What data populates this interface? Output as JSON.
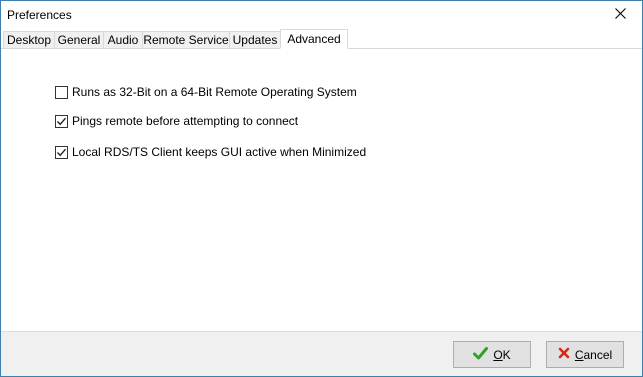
{
  "window": {
    "title": "Preferences"
  },
  "tabs": [
    {
      "label": "Desktop",
      "active": false
    },
    {
      "label": "General",
      "active": false
    },
    {
      "label": "Audio",
      "active": false
    },
    {
      "label": "Remote Service",
      "active": false
    },
    {
      "label": "Updates",
      "active": false
    },
    {
      "label": "Advanced",
      "active": true
    }
  ],
  "options": [
    {
      "label": "Runs as 32-Bit on a 64-Bit Remote Operating System",
      "checked": false
    },
    {
      "label": "Pings remote before attempting to connect",
      "checked": true
    },
    {
      "label": "Local RDS/TS Client keeps GUI active when Minimized",
      "checked": true
    }
  ],
  "footer": {
    "ok_accel": "O",
    "ok_rest": "K",
    "cancel_accel": "C",
    "cancel_rest": "ancel"
  },
  "colors": {
    "ok_icon": "#2aa52a",
    "cancel_icon": "#d9261c",
    "checkmark": "#222222",
    "window_border": "#3c7fb1"
  },
  "icons": {
    "close": "close-icon",
    "ok": "checkmark-icon",
    "cancel": "red-x-icon"
  }
}
